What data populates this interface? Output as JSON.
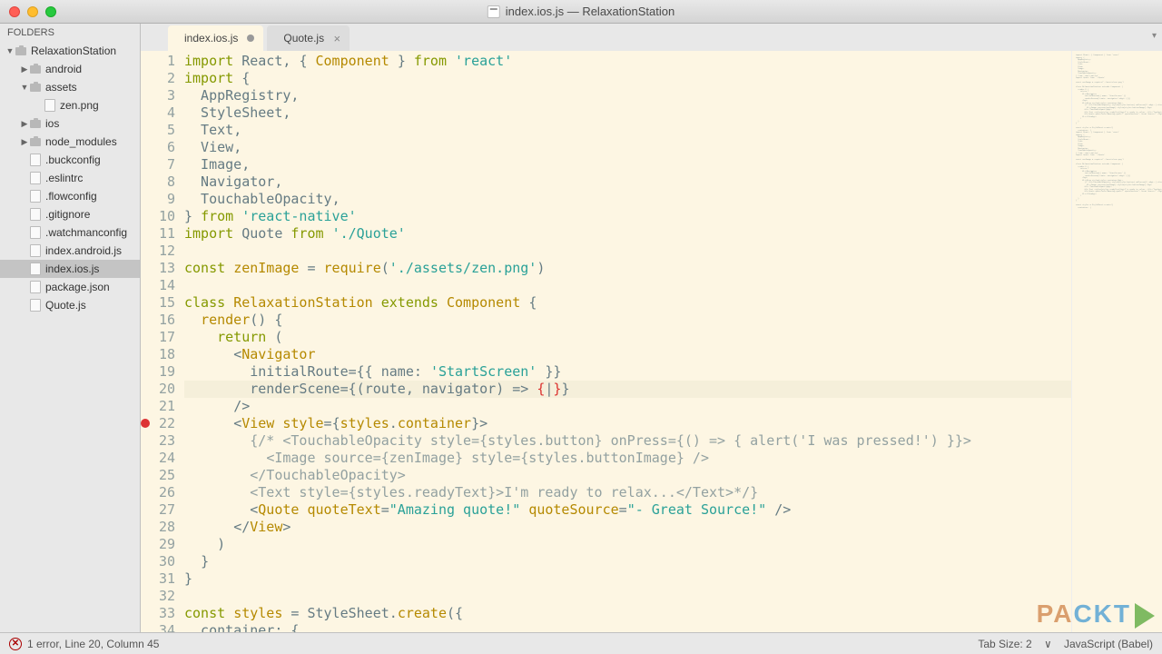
{
  "window": {
    "title": "index.ios.js — RelaxationStation"
  },
  "sidebar": {
    "header": "FOLDERS",
    "items": [
      {
        "label": "RelaxationStation",
        "type": "folder",
        "depth": 0,
        "open": true
      },
      {
        "label": "android",
        "type": "folder",
        "depth": 1,
        "open": false
      },
      {
        "label": "assets",
        "type": "folder",
        "depth": 1,
        "open": true
      },
      {
        "label": "zen.png",
        "type": "image",
        "depth": 2
      },
      {
        "label": "ios",
        "type": "folder",
        "depth": 1,
        "open": false
      },
      {
        "label": "node_modules",
        "type": "folder",
        "depth": 1,
        "open": false
      },
      {
        "label": ".buckconfig",
        "type": "file",
        "depth": 1
      },
      {
        "label": ".eslintrc",
        "type": "file",
        "depth": 1
      },
      {
        "label": ".flowconfig",
        "type": "file",
        "depth": 1
      },
      {
        "label": ".gitignore",
        "type": "file",
        "depth": 1
      },
      {
        "label": ".watchmanconfig",
        "type": "file",
        "depth": 1
      },
      {
        "label": "index.android.js",
        "type": "file",
        "depth": 1
      },
      {
        "label": "index.ios.js",
        "type": "file",
        "depth": 1,
        "selected": true
      },
      {
        "label": "package.json",
        "type": "file",
        "depth": 1
      },
      {
        "label": "Quote.js",
        "type": "file",
        "depth": 1
      }
    ]
  },
  "tabs": [
    {
      "label": "index.ios.js",
      "active": true,
      "dirty": true
    },
    {
      "label": "Quote.js",
      "active": false,
      "dirty": false
    }
  ],
  "code": {
    "lines": [
      {
        "n": 1,
        "html": "<span class='c-kw'>import</span> React<span class='c-pun'>,</span> <span class='c-pun'>{</span> <span class='c-type'>Component</span> <span class='c-pun'>}</span> <span class='c-kw'>from</span> <span class='c-str'>'react'</span>"
      },
      {
        "n": 2,
        "html": "<span class='c-kw'>import</span> <span class='c-pun'>{</span>"
      },
      {
        "n": 3,
        "html": "  AppRegistry<span class='c-pun'>,</span>"
      },
      {
        "n": 4,
        "html": "  StyleSheet<span class='c-pun'>,</span>"
      },
      {
        "n": 5,
        "html": "  Text<span class='c-pun'>,</span>"
      },
      {
        "n": 6,
        "html": "  View<span class='c-pun'>,</span>"
      },
      {
        "n": 7,
        "html": "  Image<span class='c-pun'>,</span>"
      },
      {
        "n": 8,
        "html": "  Navigator<span class='c-pun'>,</span>"
      },
      {
        "n": 9,
        "html": "  TouchableOpacity<span class='c-pun'>,</span>"
      },
      {
        "n": 10,
        "html": "<span class='c-pun'>}</span> <span class='c-kw'>from</span> <span class='c-str'>'react-native'</span>"
      },
      {
        "n": 11,
        "html": "<span class='c-kw'>import</span> Quote <span class='c-kw'>from</span> <span class='c-str'>'./Quote'</span>"
      },
      {
        "n": 12,
        "html": ""
      },
      {
        "n": 13,
        "html": "<span class='c-kw'>const</span> <span class='c-type'>zenImage</span> <span class='c-op'>=</span> <span class='c-type'>require</span><span class='c-pun'>(</span><span class='c-str'>'./assets/zen.png'</span><span class='c-pun'>)</span>"
      },
      {
        "n": 14,
        "html": ""
      },
      {
        "n": 15,
        "html": "<span class='c-kw'>class</span> <span class='c-type'>RelaxationStation</span> <span class='c-kw'>extends</span> <span class='c-type'>Component</span> <span class='c-pun'>{</span>"
      },
      {
        "n": 16,
        "html": "  <span class='c-type'>render</span><span class='c-pun'>()</span> <span class='c-pun'>{</span>"
      },
      {
        "n": 17,
        "html": "    <span class='c-kw'>return</span> <span class='c-pun'>(</span>"
      },
      {
        "n": 18,
        "html": "      <span class='c-pun'>&lt;</span><span class='c-type'>Navigator</span>"
      },
      {
        "n": 19,
        "html": "        initialRoute<span class='c-op'>=</span><span class='c-pun'>{{</span> name<span class='c-pun'>:</span> <span class='c-str'>'StartScreen'</span> <span class='c-pun'>}}</span>"
      },
      {
        "n": 20,
        "hl": true,
        "html": "        renderScene<span class='c-op'>=</span><span class='c-pun'>{</span><span class='c-pun'>(</span>route<span class='c-pun'>,</span> navigator<span class='c-pun'>)</span> <span class='c-op'>=&gt;</span> <span class='c-brace'>{</span>|<span class='c-brace'>}</span><span class='c-pun'>}</span>"
      },
      {
        "n": 21,
        "html": "      <span class='c-pun'>/&gt;</span>"
      },
      {
        "n": 22,
        "bp": true,
        "html": "      <span class='c-pun'>&lt;</span><span class='c-type'>View</span> <span class='c-type'>style</span><span class='c-op'>=</span><span class='c-pun'>{</span><span class='c-type'>styles</span><span class='c-pun'>.</span><span class='c-type'>container</span><span class='c-pun'>}&gt;</span>"
      },
      {
        "n": 23,
        "html": "        <span class='c-com'>{/* &lt;TouchableOpacity style={styles.button} onPress={() =&gt; { alert('I was pressed!') }}&gt;</span>"
      },
      {
        "n": 24,
        "html": "          <span class='c-com'>&lt;Image source={zenImage} style={styles.buttonImage} /&gt;</span>"
      },
      {
        "n": 25,
        "html": "        <span class='c-com'>&lt;/TouchableOpacity&gt;</span>"
      },
      {
        "n": 26,
        "html": "        <span class='c-com'>&lt;Text style={styles.readyText}&gt;I'm ready to relax...&lt;/Text&gt;*/}</span>"
      },
      {
        "n": 27,
        "html": "        <span class='c-pun'>&lt;</span><span class='c-type'>Quote</span> <span class='c-type'>quoteText</span><span class='c-op'>=</span><span class='c-str'>\"Amazing quote!\"</span> <span class='c-type'>quoteSource</span><span class='c-op'>=</span><span class='c-str'>\"- Great Source!\"</span> <span class='c-pun'>/&gt;</span>"
      },
      {
        "n": 28,
        "html": "      <span class='c-pun'>&lt;/</span><span class='c-type'>View</span><span class='c-pun'>&gt;</span>"
      },
      {
        "n": 29,
        "html": "    <span class='c-pun'>)</span>"
      },
      {
        "n": 30,
        "html": "  <span class='c-pun'>}</span>"
      },
      {
        "n": 31,
        "html": "<span class='c-pun'>}</span>"
      },
      {
        "n": 32,
        "html": ""
      },
      {
        "n": 33,
        "html": "<span class='c-kw'>const</span> <span class='c-type'>styles</span> <span class='c-op'>=</span> StyleSheet<span class='c-pun'>.</span><span class='c-type'>create</span><span class='c-pun'>({</span>"
      },
      {
        "n": 34,
        "html": "  container<span class='c-pun'>:</span> <span class='c-pun'>{</span>"
      }
    ]
  },
  "status": {
    "left": "1 error, Line 20, Column 45",
    "tab_size": "Tab Size: 2",
    "lang": "JavaScript (Babel)"
  },
  "logo": {
    "p1": "PA",
    "p2": "CKT"
  }
}
